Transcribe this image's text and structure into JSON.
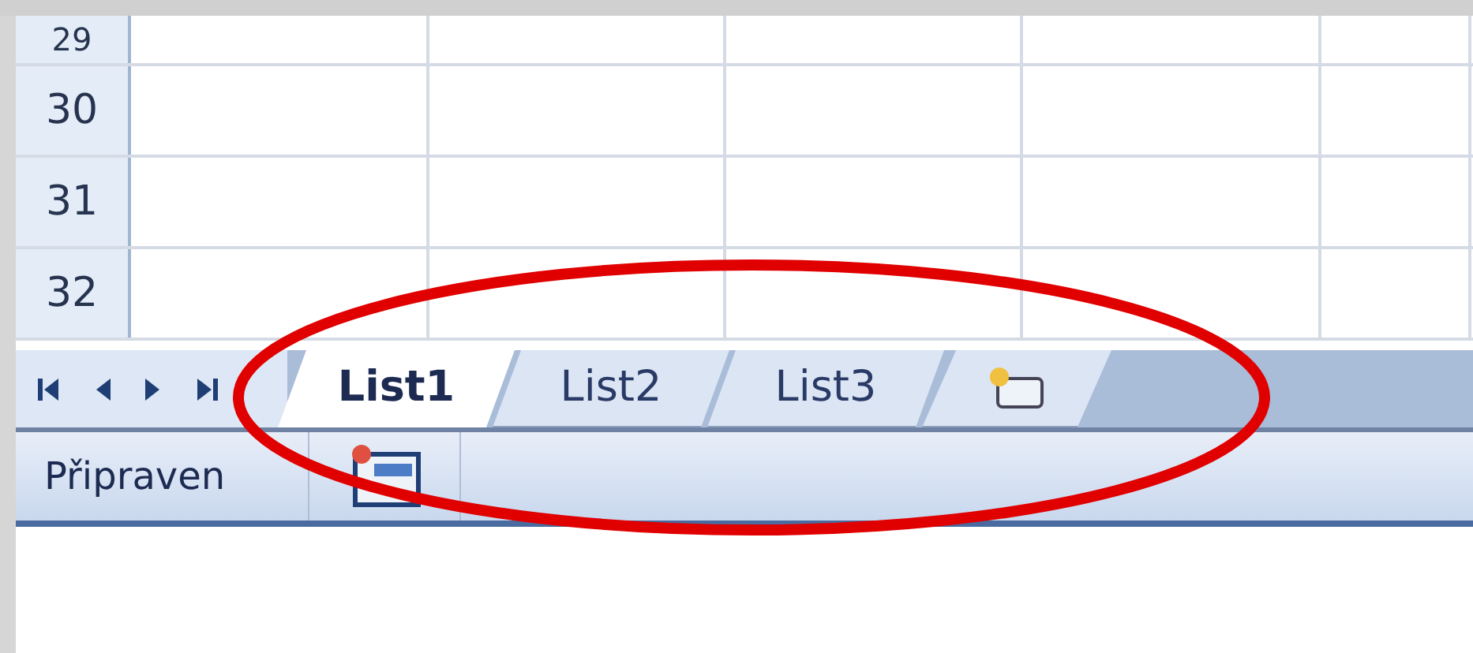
{
  "sheet": {
    "rows": [
      {
        "header": "29"
      },
      {
        "header": "30"
      },
      {
        "header": "31"
      },
      {
        "header": "32"
      }
    ]
  },
  "sheet_tabs": [
    {
      "label": "List1",
      "selected": true
    },
    {
      "label": "List2",
      "selected": false
    },
    {
      "label": "List3",
      "selected": false
    }
  ],
  "status_bar": {
    "text": "Připraven"
  }
}
